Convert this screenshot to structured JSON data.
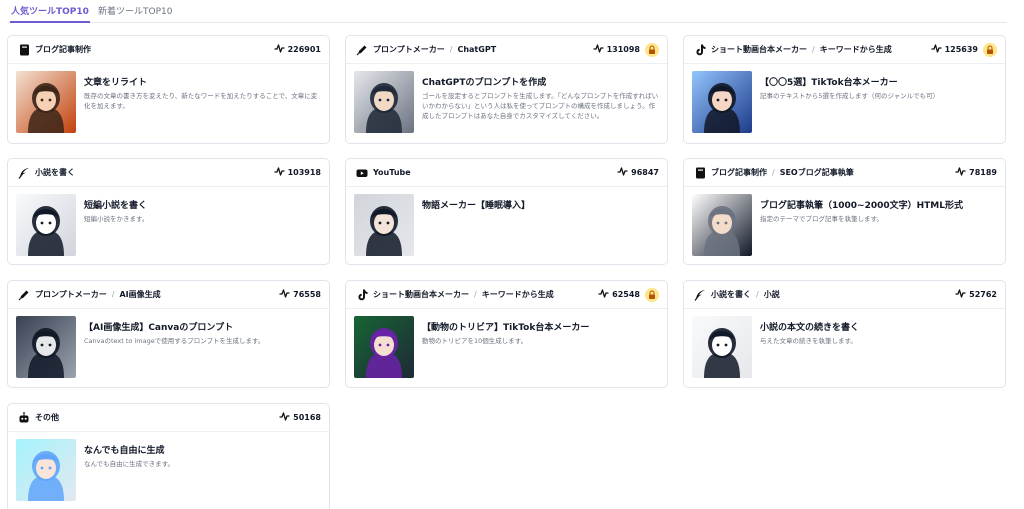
{
  "tabs": [
    "人気ツールTOP10",
    "新着ツールTOP10"
  ],
  "cards": [
    {
      "category": "ブログ記事制作",
      "subcategory": "",
      "category_icon": "book-icon",
      "count": "226901",
      "locked": false,
      "title": "文章をリライト",
      "description": "既存の文章の書き方を変えたり、新たなワードを加えたりすることで、文章に変化を加えます。",
      "thumb": "anime-girl-orange-hair-thumbnail"
    },
    {
      "category": "プロンプトメーカー",
      "subcategory": "ChatGPT",
      "category_icon": "pen-icon",
      "count": "131098",
      "locked": true,
      "title": "ChatGPTのプロンプトを作成",
      "description": "ゴールを設定するとプロンプトを生成します。「どんなプロンプトを作成すればいいかわからない」という人は私を使ってプロンプトの構成を作成しましょう。作成したプロンプトはあなた自身でカスタマイズしてください。",
      "thumb": "anime-girl-gray-hair-thumbnail"
    },
    {
      "category": "ショート動画台本メーカー",
      "subcategory": "キーワードから生成",
      "category_icon": "tiktok-icon",
      "count": "125639",
      "locked": true,
      "title": "【〇〇5選】TikTok台本メーカー",
      "description": "記事のテキストから5選を作成します（何のジャンルでも可）",
      "thumb": "anime-maid-room-thumbnail"
    },
    {
      "category": "小説を書く",
      "subcategory": "",
      "category_icon": "quill-icon",
      "count": "103918",
      "locked": false,
      "title": "短編小説を書く",
      "description": "短編小説をかきます。",
      "thumb": "anime-maid-sketch-thumbnail"
    },
    {
      "category": "YouTube",
      "subcategory": "",
      "category_icon": "youtube-icon",
      "count": "96847",
      "locked": false,
      "title": "物語メーカー【睡眠導入】",
      "description": "",
      "thumb": "anime-maid-reading-thumbnail"
    },
    {
      "category": "ブログ記事制作",
      "subcategory": "SEOブログ記事執筆",
      "category_icon": "book-icon",
      "count": "78189",
      "locked": false,
      "title": "ブログ記事執筆（1000~2000文字）HTML形式",
      "description": "指定のテーマでブログ記事を執筆します。",
      "thumb": "anime-girl-dark-hair-thumbnail"
    },
    {
      "category": "プロンプトメーカー",
      "subcategory": "AI画像生成",
      "category_icon": "pen-icon",
      "count": "76558",
      "locked": false,
      "title": "【AI画像生成】Canvaのプロンプト",
      "description": "Canvaのtext to imageで使用するプロンプトを生成します。",
      "thumb": "anime-girl-monochrome-thumbnail"
    },
    {
      "category": "ショート動画台本メーカー",
      "subcategory": "キーワードから生成",
      "category_icon": "tiktok-icon",
      "count": "62548",
      "locked": true,
      "title": "【動物のトリビア】TikTok台本メーカー",
      "description": "動物のトリビアを10個生成します。",
      "thumb": "anime-maid-chalkboard-thumbnail"
    },
    {
      "category": "小説を書く",
      "subcategory": "小説",
      "category_icon": "quill-icon",
      "count": "52762",
      "locked": false,
      "title": "小説の本文の続きを書く",
      "description": "与えた文章の続きを執筆します。",
      "thumb": "anime-maids-sketch-thumbnail"
    },
    {
      "category": "その他",
      "subcategory": "",
      "category_icon": "robot-icon",
      "count": "50168",
      "locked": false,
      "title": "なんでも自由に生成",
      "description": "なんでも自由に生成できます。",
      "thumb": "anime-girl-butterflies-thumbnail"
    }
  ]
}
